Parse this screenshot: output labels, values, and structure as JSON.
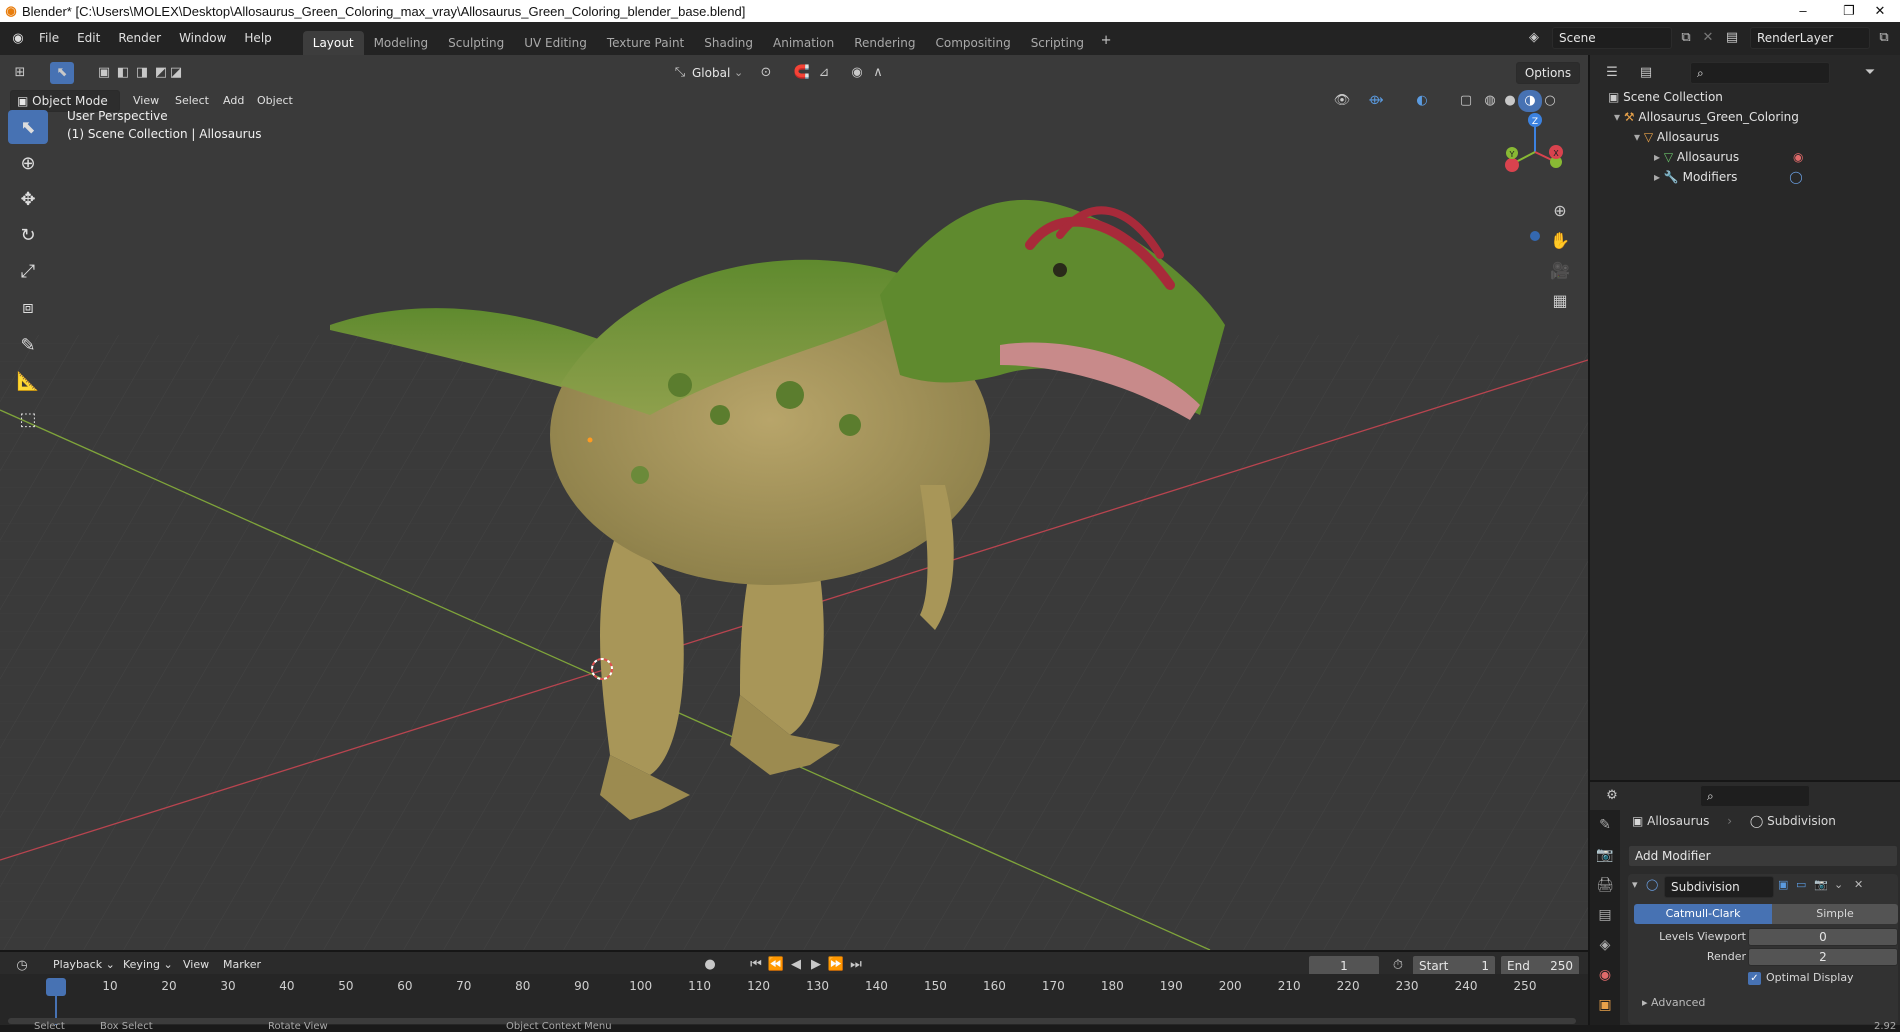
{
  "window": {
    "title": "Blender* [C:\\Users\\MOLEX\\Desktop\\Allosaurus_Green_Coloring_max_vray\\Allosaurus_Green_Coloring_blender_base.blend]",
    "minimize": "–",
    "maximize": "❐",
    "close": "✕"
  },
  "menubar": {
    "menus": [
      "File",
      "Edit",
      "Render",
      "Window",
      "Help"
    ],
    "workspaces": [
      "Layout",
      "Modeling",
      "Sculpting",
      "UV Editing",
      "Texture Paint",
      "Shading",
      "Animation",
      "Rendering",
      "Compositing",
      "Scripting"
    ],
    "active_workspace": "Layout",
    "add_workspace": "+",
    "scene_name": "Scene",
    "render_layer": "RenderLayer"
  },
  "viewport_header": {
    "mode": "Object Mode",
    "menus": [
      "View",
      "Select",
      "Add",
      "Object"
    ],
    "transform_orientation": "Global",
    "options": "Options"
  },
  "viewport": {
    "perspective_label": "User Perspective",
    "collection_label": "(1) Scene Collection | Allosaurus",
    "gizmo_axes": [
      "Z",
      "Y",
      "X"
    ]
  },
  "outliner": {
    "root": "Scene Collection",
    "items": [
      {
        "label": "Allosaurus_Green_Coloring",
        "depth": 1,
        "icon": "armature-icon"
      },
      {
        "label": "Allosaurus",
        "depth": 2,
        "icon": "object-icon"
      },
      {
        "label": "Allosaurus",
        "depth": 3,
        "icon": "mesh-icon"
      },
      {
        "label": "Modifiers",
        "depth": 3,
        "icon": "wrench-icon"
      }
    ]
  },
  "properties": {
    "object_name": "Allosaurus",
    "modifier_tab": "Subdivision",
    "add_modifier": "Add Modifier",
    "modifier_name": "Subdivision",
    "algorithms": [
      "Catmull-Clark",
      "Simple"
    ],
    "active_algorithm": "Catmull-Clark",
    "levels_viewport_label": "Levels Viewport",
    "levels_viewport_value": "0",
    "render_label": "Render",
    "render_value": "2",
    "optimal_display_label": "Optimal Display",
    "optimal_display_checked": true,
    "advanced_label": "Advanced"
  },
  "timeline": {
    "menus": [
      "Playback",
      "Keying",
      "View",
      "Marker"
    ],
    "current_frame": "1",
    "start_label": "Start",
    "start_value": "1",
    "end_label": "End",
    "end_value": "250",
    "ticks": [
      "1",
      "10",
      "20",
      "30",
      "40",
      "50",
      "60",
      "70",
      "80",
      "90",
      "100",
      "110",
      "120",
      "130",
      "140",
      "150",
      "160",
      "170",
      "180",
      "190",
      "200",
      "210",
      "220",
      "230",
      "240",
      "250"
    ]
  },
  "statusbar": {
    "items": [
      "Select",
      "Box Select",
      "Rotate View",
      "Object Context Menu"
    ],
    "version": "2.92"
  },
  "colors": {
    "accent": "#4772b3",
    "x_axis": "#d9434e",
    "y_axis": "#88b934",
    "z_axis": "#3c82e0"
  }
}
